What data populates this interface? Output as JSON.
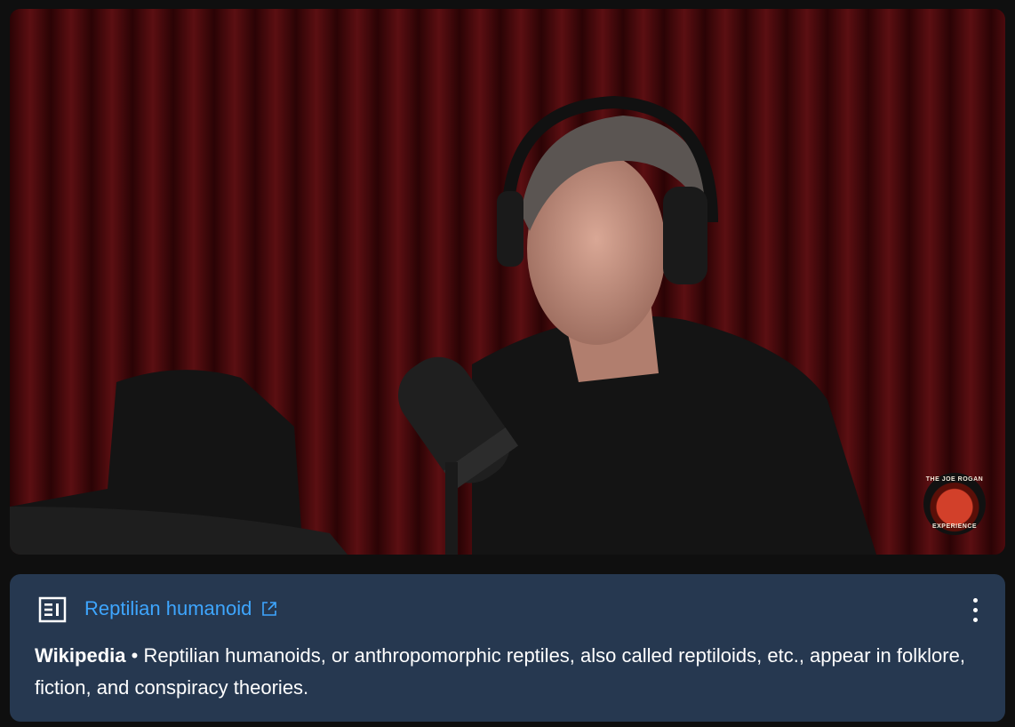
{
  "video": {
    "watermark_top": "THE JOE ROGAN",
    "watermark_bottom": "EXPERIENCE",
    "thumbnail_desc": "podcast-studio-frame"
  },
  "card": {
    "icon": "article-icon",
    "title": "Reptilian humanoid",
    "external_icon": "open-in-new-icon",
    "menu_icon": "more-vert-icon",
    "source": "Wikipedia",
    "separator": " • ",
    "description": "Reptilian humanoids, or anthropomorphic reptiles, also called reptiloids, etc., appear in folklore, fiction, and conspiracy theories."
  },
  "colors": {
    "page_bg": "#0f0f0f",
    "panel_bg": "#263850",
    "link": "#3ea6ff",
    "curtain": "#5a0c10"
  }
}
